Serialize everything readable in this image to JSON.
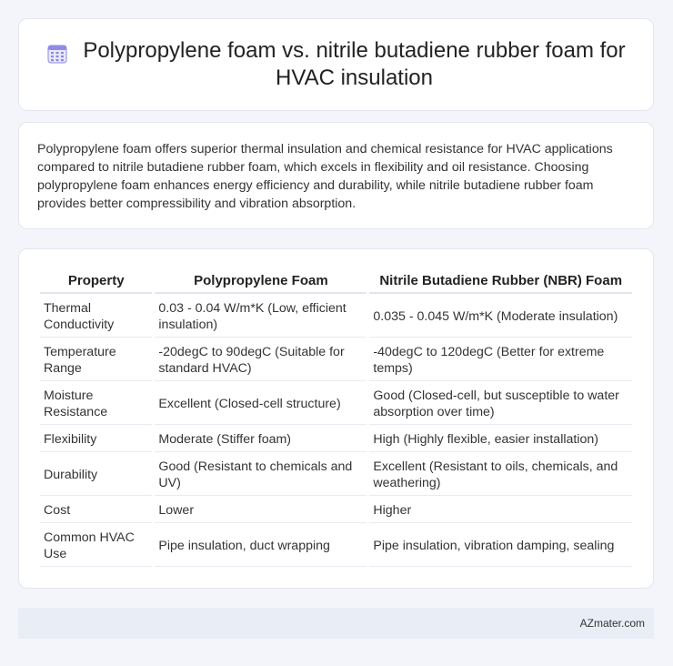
{
  "header": {
    "title": "Polypropylene foam vs. nitrile butadiene rubber foam for HVAC insulation",
    "icon": "calendar-grid-icon",
    "icon_color": "#6b6fd6"
  },
  "summary": {
    "text": "Polypropylene foam offers superior thermal insulation and chemical resistance for HVAC applications compared to nitrile butadiene rubber foam, which excels in flexibility and oil resistance. Choosing polypropylene foam enhances energy efficiency and durability, while nitrile butadiene rubber foam provides better compressibility and vibration absorption."
  },
  "table": {
    "headers": [
      "Property",
      "Polypropylene Foam",
      "Nitrile Butadiene Rubber (NBR) Foam"
    ],
    "rows": [
      [
        "Thermal Conductivity",
        "0.03 - 0.04 W/m*K (Low, efficient insulation)",
        "0.035 - 0.045 W/m*K (Moderate insulation)"
      ],
      [
        "Temperature Range",
        "-20degC to 90degC (Suitable for standard HVAC)",
        "-40degC to 120degC (Better for extreme temps)"
      ],
      [
        "Moisture Resistance",
        "Excellent (Closed-cell structure)",
        "Good (Closed-cell, but susceptible to water absorption over time)"
      ],
      [
        "Flexibility",
        "Moderate (Stiffer foam)",
        "High (Highly flexible, easier installation)"
      ],
      [
        "Durability",
        "Good (Resistant to chemicals and UV)",
        "Excellent (Resistant to oils, chemicals, and weathering)"
      ],
      [
        "Cost",
        "Lower",
        "Higher"
      ],
      [
        "Common HVAC Use",
        "Pipe insulation, duct wrapping",
        "Pipe insulation, vibration damping, sealing"
      ]
    ]
  },
  "footer": {
    "brand": "AZmater.com"
  }
}
